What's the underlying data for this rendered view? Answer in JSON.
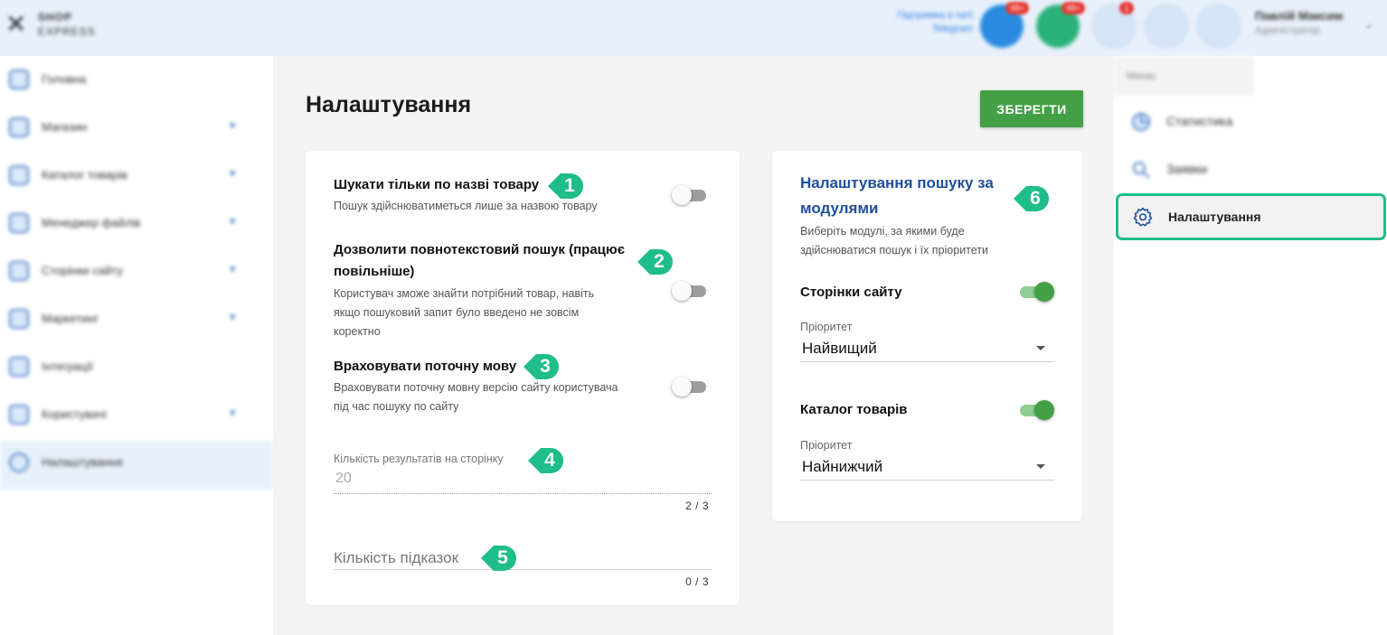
{
  "topbar": {
    "help_link": "Підтримка в чаті Telegram",
    "badge_telegram": "99+",
    "badge_chat": "99+",
    "badge_notify": "1",
    "user_name": "Павлій Максим",
    "user_role": "Адміністратор"
  },
  "sidebar": {
    "items": [
      {
        "label": "Головна"
      },
      {
        "label": "Магазин"
      },
      {
        "label": "Каталог товарів"
      },
      {
        "label": "Менеджер файлів"
      },
      {
        "label": "Сторінки сайту"
      },
      {
        "label": "Маркетинг"
      },
      {
        "label": "Інтеграції"
      },
      {
        "label": "Користувачі"
      },
      {
        "label": "Налаштування"
      }
    ]
  },
  "page": {
    "title": "Налаштування",
    "save_label": "ЗБЕРЕГТИ"
  },
  "options": {
    "search_by_name": {
      "title": "Шукати тільки по назві товару",
      "desc": "Пошук здійснюватиметься лише за назвою товару",
      "enabled": false
    },
    "fulltext": {
      "title_line1": "Дозволити повнотекстовий пошук (працює",
      "title_line2": "повільніше)",
      "desc_line1": "Користувач зможе знайти потрібний товар, навіть",
      "desc_line2": "якщо пошуковий запит було введено не зовсім",
      "desc_line3": "коректно",
      "enabled": false
    },
    "current_lang": {
      "title": "Враховувати поточну мову",
      "desc_line1": "Враховувати поточну мовну версію сайту користувача",
      "desc_line2": "під час пошуку по сайту",
      "enabled": false
    },
    "results_per_page": {
      "label": "Кількість результатів на сторінку",
      "value": "20",
      "counter": "2 / 3"
    },
    "suggestions": {
      "placeholder": "Кількість підказок",
      "counter": "0 / 3"
    }
  },
  "modules": {
    "title_line1": "Налаштування пошуку за",
    "title_line2": "модулями",
    "desc_line1": "Виберіть модулі, за якими буде",
    "desc_line2": "здійснюватися пошук і їх пріоритети",
    "items": [
      {
        "name": "Сторінки сайту",
        "enabled": true,
        "priority_label": "Пріоритет",
        "priority": "Найвищий"
      },
      {
        "name": "Каталог товарів",
        "enabled": true,
        "priority_label": "Пріоритет",
        "priority": "Найнижчий"
      }
    ]
  },
  "callouts": [
    "1",
    "2",
    "3",
    "4",
    "5",
    "6"
  ],
  "right_sidebar": {
    "header": "Меню",
    "items": [
      {
        "label": "Статистика"
      },
      {
        "label": "Заявки"
      },
      {
        "label": "Налаштування"
      }
    ]
  },
  "colors": {
    "accent_green": "#43a047",
    "callout_green": "#1fbd8a",
    "title_blue": "#1e4f9c"
  }
}
